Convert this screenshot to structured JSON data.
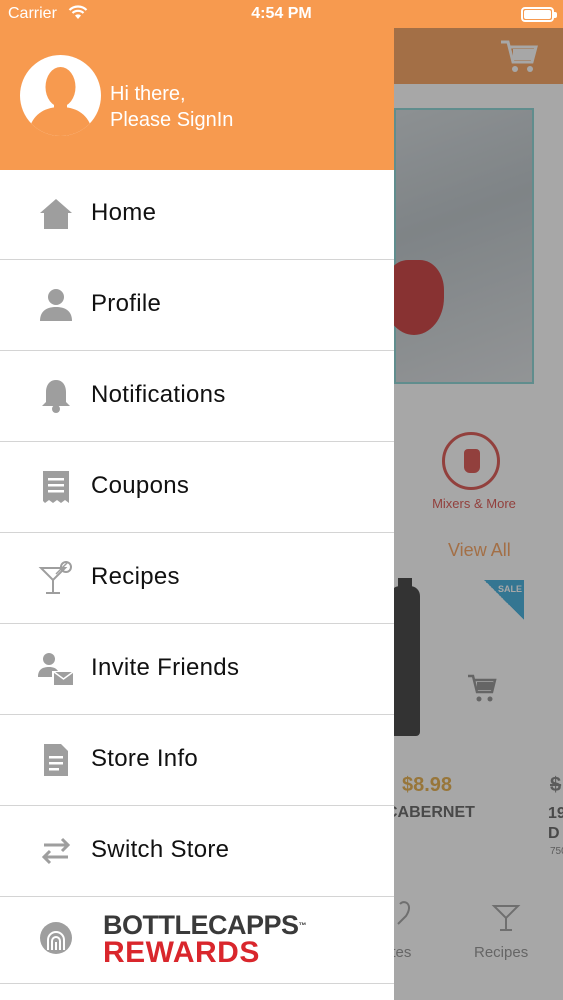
{
  "status_bar": {
    "carrier": "Carrier",
    "time": "4:54 PM"
  },
  "drawer": {
    "greeting_line1": "Hi there,",
    "greeting_line2": "Please SignIn",
    "menu": [
      {
        "label": "Home",
        "icon": "home-icon"
      },
      {
        "label": "Profile",
        "icon": "person-icon"
      },
      {
        "label": "Notifications",
        "icon": "bell-icon"
      },
      {
        "label": "Coupons",
        "icon": "receipt-icon"
      },
      {
        "label": "Recipes",
        "icon": "cocktail-icon"
      },
      {
        "label": "Invite Friends",
        "icon": "invite-icon"
      },
      {
        "label": "Store Info",
        "icon": "document-icon"
      },
      {
        "label": "Switch Store",
        "icon": "switch-arrows-icon"
      }
    ],
    "rewards": {
      "brand": "BOTTLECAPPS",
      "trademark": "™",
      "sub": "REWARDS"
    }
  },
  "background": {
    "category_label": "Mixers & More",
    "view_all": "View All",
    "sale_badge": "SALE",
    "price": "$8.98",
    "price_old": "$",
    "product_name": "CABERNET",
    "product_name2_line1": "19",
    "product_name2_line2": "D",
    "product_size": "750",
    "tab_favorites": "ites",
    "tab_recipes": "Recipes"
  },
  "colors": {
    "accent": "#f79a4f",
    "rewards_red": "#d9262c"
  }
}
